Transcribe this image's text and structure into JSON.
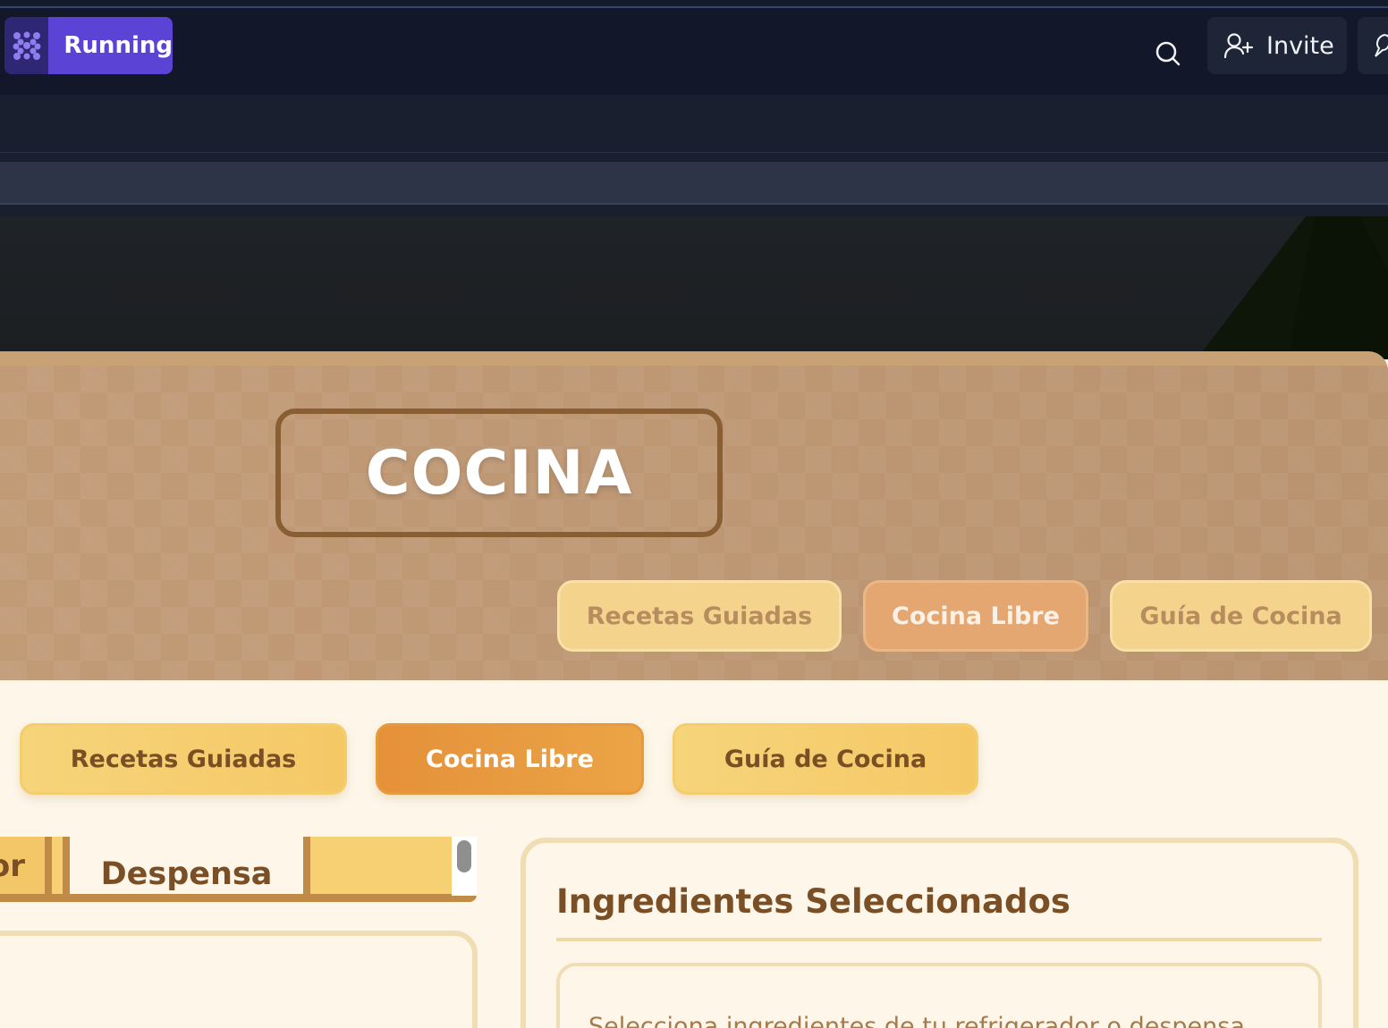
{
  "app_bar": {
    "status_label": "Running",
    "invite_label": "Invite",
    "logo_icon": "dots-logo-icon",
    "search_icon": "search-icon",
    "invite_icon": "user-plus-icon",
    "colors": {
      "bar_bg": "#121829",
      "status_accent": "#5b43d6",
      "logo_bg": "#2e2773"
    }
  },
  "header": {
    "title": "COCINA",
    "tabs": [
      {
        "label": "Recetas Guiadas",
        "active": false
      },
      {
        "label": "Cocina Libre",
        "active": true
      },
      {
        "label": "Guía de Cocina",
        "active": false
      }
    ]
  },
  "main": {
    "tabs": [
      {
        "label": "Recetas Guiadas",
        "active": false
      },
      {
        "label": "Cocina Libre",
        "active": true
      },
      {
        "label": "Guía de Cocina",
        "active": false
      }
    ],
    "storage_tabs": [
      {
        "label": "or",
        "active": false
      },
      {
        "label": "Despensa",
        "active": true
      }
    ],
    "selected_panel": {
      "title": "Ingredientes Seleccionados",
      "empty_text": "Selecciona ingredientes de tu refrigerador o despensa"
    },
    "colors": {
      "accent_orange": "#e5913a",
      "accent_yellow": "#f6d47a",
      "text_brown": "#7a4f25",
      "panel_border": "#f0ddb3"
    }
  }
}
